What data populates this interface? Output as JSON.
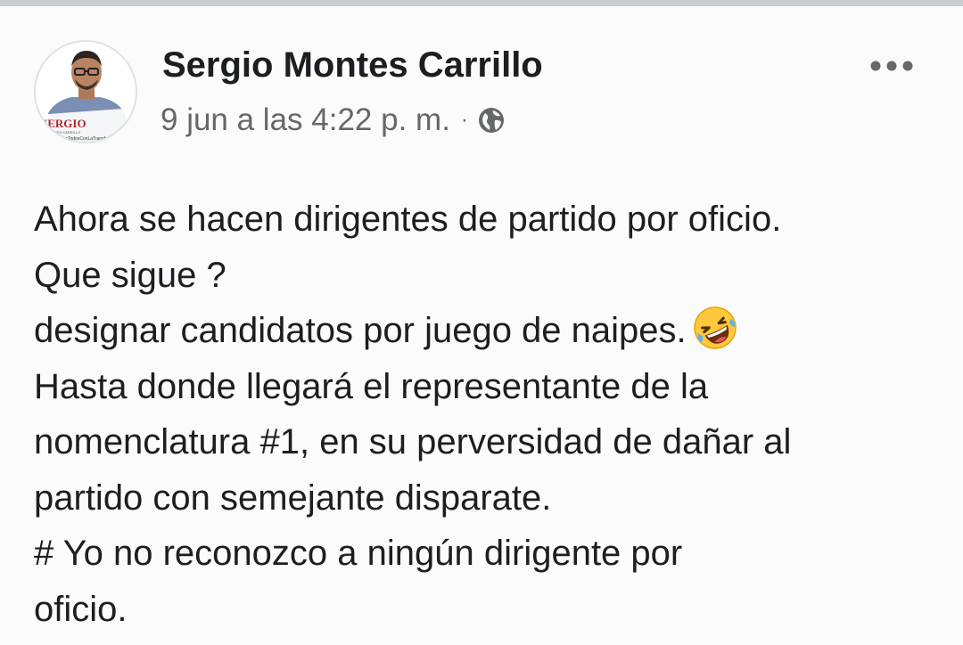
{
  "post": {
    "author": "Sergio Montes Carrillo",
    "timestamp": "9 jun a las 4:22 p. m.",
    "separator": "·",
    "privacy_icon": "globe-icon",
    "more_icon": "more-options-icon",
    "avatar": {
      "brand_text": "SERGIO",
      "sub_text": "MONTES CARRILLO",
      "slogan_text": "#VamosTodosConLaTransformación"
    },
    "body_lines": [
      "Ahora se hacen dirigentes de partido por oficio.",
      "Que sigue ?",
      "designar candidatos por juego de naipes.",
      "Hasta donde llegará el representante de la",
      "nomenclatura #1, en su perversidad de dañar al",
      "partido con semejante disparate.",
      "# Yo no reconozco a ningún dirigente por",
      "oficio."
    ],
    "emoji_icon": "rolling-on-floor-laughing-emoji-icon"
  },
  "colors": {
    "background": "#fbfbfb",
    "text_primary": "#1c1e21",
    "text_secondary": "#65676b",
    "brand_red": "#c0392b"
  }
}
